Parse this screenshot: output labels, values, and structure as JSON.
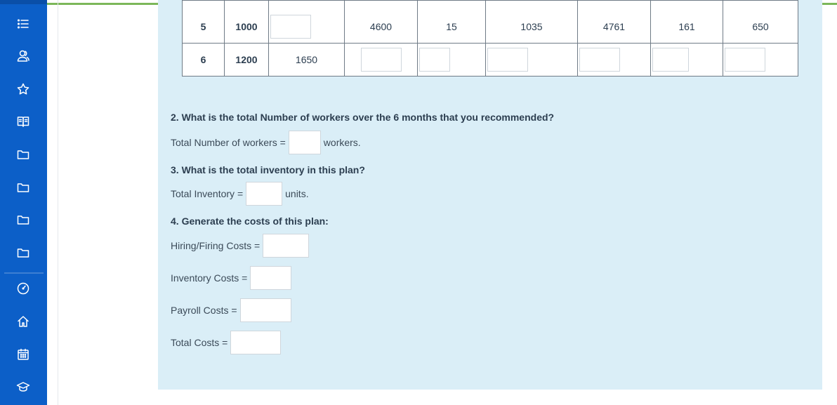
{
  "sidebar": {
    "items": [
      {
        "icon": "list-icon"
      },
      {
        "icon": "users-icon"
      },
      {
        "icon": "star-icon"
      },
      {
        "icon": "book-icon"
      },
      {
        "icon": "folder-icon"
      },
      {
        "icon": "folder-icon"
      },
      {
        "icon": "folder-icon"
      },
      {
        "icon": "folder-icon"
      },
      {
        "icon": "dashboard-gauge-icon"
      },
      {
        "icon": "home-icon"
      },
      {
        "icon": "calendar-icon"
      },
      {
        "icon": "graduation-cap-icon"
      }
    ]
  },
  "table": {
    "rows": [
      {
        "month": "5",
        "demand": "1000",
        "c3": "",
        "c4": "4600",
        "c5": "15",
        "c6": "1035",
        "c7": "4761",
        "c8": "161",
        "c9": "650"
      },
      {
        "month": "6",
        "demand": "1200",
        "c3": "1650",
        "c4": "",
        "c5": "",
        "c6": "",
        "c7": "",
        "c8": "",
        "c9": ""
      }
    ]
  },
  "q2": {
    "title": "2. What is the total Number of workers over the 6 months that you recommended?",
    "label": "Total Number of workers =",
    "value": "",
    "unit": "workers."
  },
  "q3": {
    "title": "3. What is the total inventory in this plan?",
    "label": "Total Inventory =",
    "value": "",
    "unit": "units."
  },
  "q4": {
    "title": "4. Generate the costs of this plan:",
    "hiring_label": "Hiring/Firing Costs =",
    "inventory_label": "Inventory Costs =",
    "payroll_label": "Payroll Costs =",
    "total_label": "Total Costs ="
  },
  "colors": {
    "sidebar": "#0c5fc8",
    "panel": "#daeef7",
    "accent_green": "#7cb75a"
  }
}
